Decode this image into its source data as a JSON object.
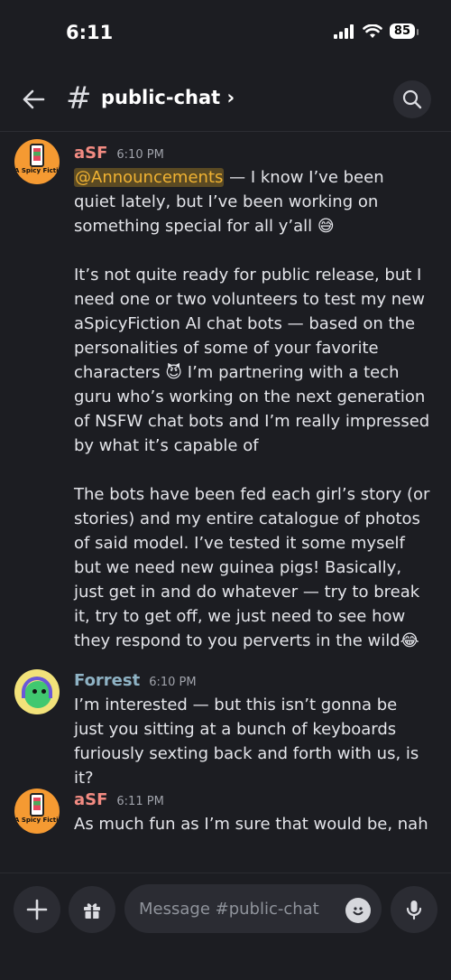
{
  "status_bar": {
    "time": "6:11",
    "battery": "85"
  },
  "header": {
    "hash": "#",
    "channel_name": "public-chat ›"
  },
  "messages": [
    {
      "author": "aSF",
      "author_color": "#f28b82",
      "timestamp": "6:10 PM",
      "avatar_text": "A Spicy Fiction",
      "mention": "@Announcements",
      "paragraph1_rest": " — I know I’ve been quiet lately, but I’ve been working on something special for all y’all 😅",
      "paragraph2": "It’s not quite ready for public release, but I need one or two volunteers to test my new aSpicyFiction AI chat bots — based on the personalities of some of your favorite characters 😈 I’m partnering with a tech guru who’s working on the next generation of NSFW chat bots and I’m really impressed by what it’s capable of",
      "paragraph3": "The bots have been fed each girl’s story (or stories) and my entire catalogue of photos of said model. I’ve tested it some myself but we need new guinea pigs! Basically, just get in and do whatever — try to break it, try to get off, we just need to see how they respond to you perverts in the wild😂"
    },
    {
      "author": "Forrest",
      "author_color": "#8fb3c5",
      "timestamp": "6:10 PM",
      "text": "I’m interested — but this isn’t gonna be just you sitting at a bunch of keyboards furiously sexting back and forth with us, is it?"
    },
    {
      "author": "aSF",
      "author_color": "#f28b82",
      "timestamp": "6:11 PM",
      "avatar_text": "A Spicy Fiction",
      "text": "As much fun as I’m sure that would be, nah"
    }
  ],
  "composer": {
    "placeholder": "Message #public-chat"
  },
  "icons": {
    "back": "arrow-left-icon",
    "search": "search-icon",
    "add": "plus-icon",
    "gift": "gift-icon",
    "emoji": "emoji-icon",
    "mic": "microphone-icon"
  }
}
